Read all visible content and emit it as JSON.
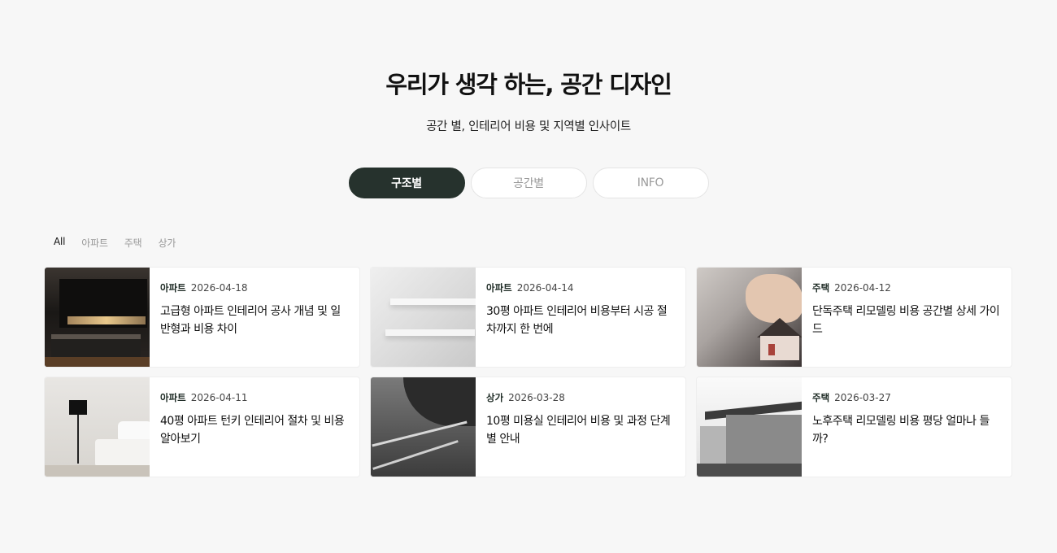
{
  "hero": {
    "title": "우리가 생각 하는, 공간 디자인",
    "subtitle": "공간 별, 인테리어 비용 및 지역별 인사이트"
  },
  "segments": [
    {
      "label": "구조별",
      "active": true
    },
    {
      "label": "공간별",
      "active": false
    },
    {
      "label": "INFO",
      "active": false
    }
  ],
  "filters": [
    {
      "label": "All",
      "active": true
    },
    {
      "label": "아파트",
      "active": false
    },
    {
      "label": "주택",
      "active": false
    },
    {
      "label": "상가",
      "active": false
    }
  ],
  "cards": [
    {
      "category": "아파트",
      "date": "2026-04-18",
      "title": "고급형 아파트 인테리어 공사 개념 및 일반형과 비용 차이",
      "image": "luxury-kitchen-photo"
    },
    {
      "category": "아파트",
      "date": "2026-04-14",
      "title": "30평 아파트 인테리어 비용부터 시공 절차까지 한 번에",
      "image": "white-shelves-photo"
    },
    {
      "category": "주택",
      "date": "2026-04-12",
      "title": "단독주택 리모델링 비용 공간별 상세 가이드",
      "image": "house-model-photo"
    },
    {
      "category": "아파트",
      "date": "2026-04-11",
      "title": "40평 아파트 턴키 인테리어 절차 및 비용 알아보기",
      "image": "bedroom-photo"
    },
    {
      "category": "상가",
      "date": "2026-03-28",
      "title": "10평 미용실 인테리어 비용 및 과정 단계별 안내",
      "image": "salon-tools-photo"
    },
    {
      "category": "주택",
      "date": "2026-03-27",
      "title": "노후주택 리모델링 비용 평당 얼마나 들까?",
      "image": "old-house-photo"
    }
  ]
}
